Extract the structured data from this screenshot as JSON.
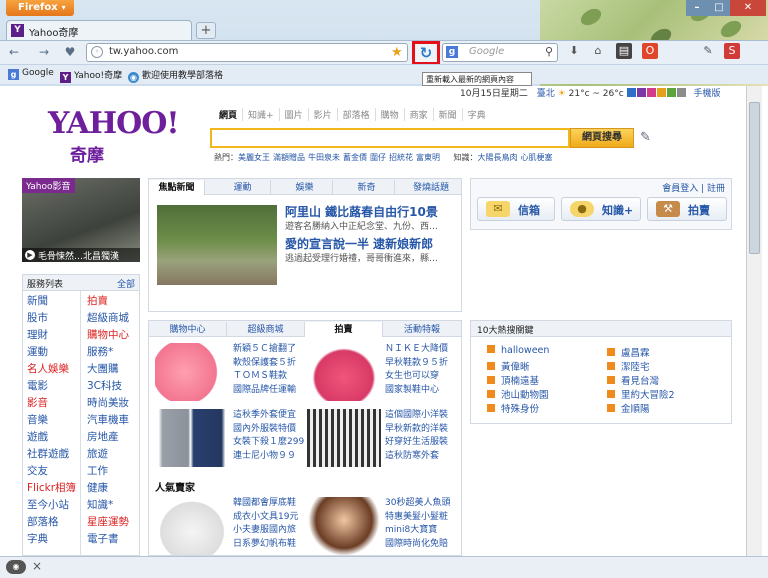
{
  "browser": {
    "menu_button": "Firefox",
    "tab_title": "Yahoo奇摩",
    "new_tab": "+",
    "url": "tw.yahoo.com",
    "search_placeholder": "Google",
    "reload_tooltip": "重新載入最新的網頁內容",
    "bookmarks": [
      "Google",
      "Yahoo!奇摩",
      "歡迎使用教學部落格"
    ]
  },
  "yahoo": {
    "date": "10月15日星期二",
    "location": "臺北",
    "weather": "21°c ~ 26°c",
    "mobile": "手機版",
    "logo_en": "YAHOO!",
    "logo_zh": "奇摩",
    "search_tabs": [
      "網頁",
      "知識+",
      "圖片",
      "影片",
      "部落格",
      "購物",
      "商家",
      "新聞",
      "字典"
    ],
    "search_button": "網頁搜尋",
    "hot_label": "熱門：",
    "hot_terms": [
      "美麗女王",
      "滿額贈品",
      "牛田泉未",
      "蓄金價",
      "圍仔",
      "招統花",
      "富東明"
    ],
    "knowledge_label": "知識：",
    "knowledge_terms": [
      "大陽長鳥肉",
      "心肌梗塞"
    ]
  },
  "video": {
    "label": "Yahoo影音",
    "caption": "毛骨悚然…北昌獨漢"
  },
  "services": {
    "header": "服務列表",
    "all": "全部",
    "left": [
      "新聞",
      "股市",
      "理財",
      "運動",
      "名人娛樂",
      "電影",
      "影音",
      "音樂",
      "遊戲",
      "社群遊戲",
      "交友",
      "Flickr相簿",
      "至今小站",
      "部落格",
      "字典"
    ],
    "right": [
      "拍賣",
      "超級商城",
      "購物中心",
      "服務*",
      "大團購",
      "3C科技",
      "時尚美妝",
      "汽車機車",
      "房地產",
      "旅遊",
      "工作",
      "健康",
      "知識*",
      "星座運勢",
      "電子書"
    ],
    "red_left": [
      4,
      6,
      11
    ],
    "red_right": [
      0,
      2,
      13
    ]
  },
  "news": {
    "tabs": [
      "焦點新聞",
      "運動",
      "娛樂",
      "新奇",
      "發燒話題"
    ],
    "headline1": "阿里山 鐵比蕗春自由行10景",
    "sub1": "遊客名勝納入中正紀念堂、九份、西…",
    "headline2": "愛的宣言說一半 逮新娘新郎",
    "sub2": "逃過起受理行婚禮，哥哥衝進來，縣…"
  },
  "shop": {
    "tabs": [
      "購物中心",
      "超級商城",
      "拍賣",
      "活動特報"
    ],
    "products": [
      [
        "新穎５Ｃ搶翻了",
        "軟殼保護套５折",
        "ＴＯＭＳ鞋款",
        "國際品牌任運輸"
      ],
      [
        "ＮＩＫＥ大降價",
        "早秋鞋款９５折",
        "女生也可以穿",
        "國家製鞋中心"
      ],
      [
        "這秋季外套便宜",
        "國內外服裝特價",
        "女裝下殺１麼299",
        "連士尼小物９９"
      ],
      [
        "這個國際小洋裝",
        "早秋新款的洋裝",
        "好穿好生活服裝",
        "這秋防寒外套"
      ],
      [
        "韓國都會厚底鞋",
        "成衣小文具19元",
        "小夫妻服國內旅",
        "日系夢幻帆布鞋"
      ],
      [
        "30秒超美人魚頭",
        "特惠美髮小髮粧",
        "mini8大寶寶",
        "國際時尚化免賠"
      ]
    ],
    "popular": "人氣賣家"
  },
  "account": {
    "login": "會員登入",
    "register": "註冊",
    "mail": "信箱",
    "answers": "知識+",
    "auction": "拍賣"
  },
  "hot": {
    "header": "10大熱搜關鍵",
    "left": [
      "halloween",
      "黃偉晰",
      "頂楠遠基",
      "池山動物園",
      "特殊身份"
    ],
    "right": [
      "盧昌霖",
      "潔陸宅",
      "看見台灣",
      "里約大冒險2",
      "金順陽"
    ]
  },
  "colors": {
    "accent": "#6d1f9c",
    "link": "#2757a8",
    "highlight": "#e3101a"
  }
}
